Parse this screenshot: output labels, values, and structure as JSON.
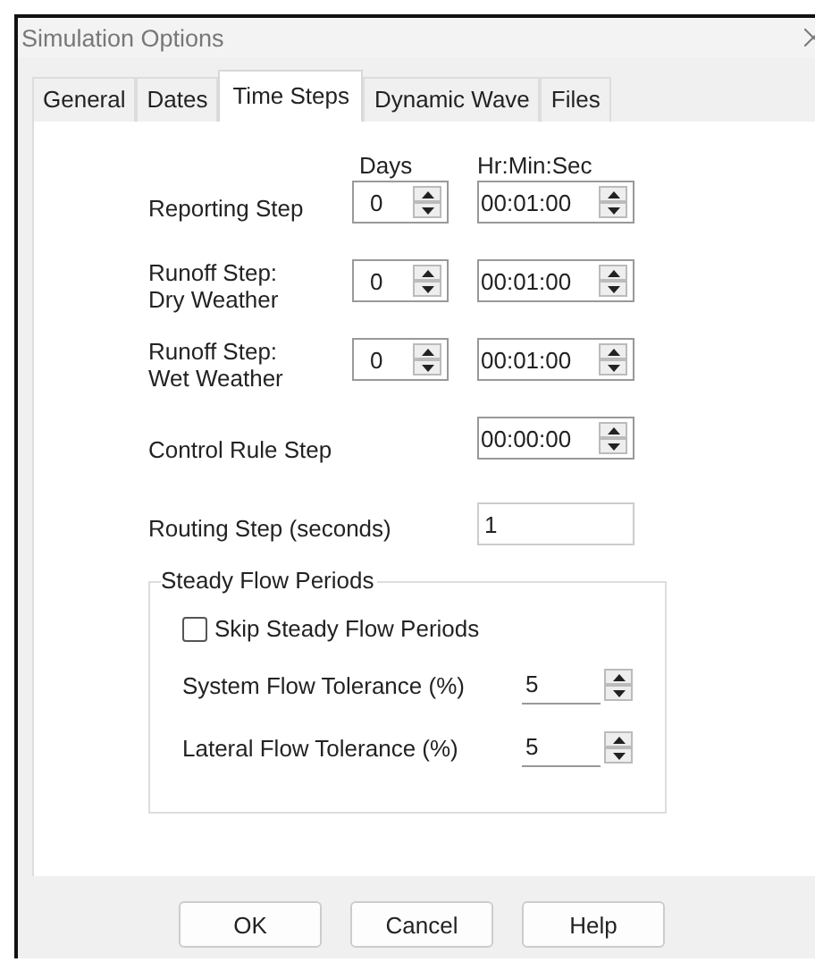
{
  "window": {
    "title": "Simulation Options"
  },
  "tabs": [
    {
      "label": "General",
      "selected": false
    },
    {
      "label": "Dates",
      "selected": false
    },
    {
      "label": "Time Steps",
      "selected": true
    },
    {
      "label": "Dynamic Wave",
      "selected": false
    },
    {
      "label": "Files",
      "selected": false
    }
  ],
  "columns": {
    "days": "Days",
    "time": "Hr:Min:Sec"
  },
  "steps": [
    {
      "kind": "days_time",
      "label": "Reporting Step",
      "days": "0",
      "time": "00:01:00"
    },
    {
      "kind": "days_time",
      "label": "Runoff Step:\nDry Weather",
      "days": "0",
      "time": "00:01:00"
    },
    {
      "kind": "days_time",
      "label": "Runoff Step:\nWet Weather",
      "days": "0",
      "time": "00:01:00"
    },
    {
      "kind": "time",
      "label": "Control Rule Step",
      "time": "00:00:00"
    },
    {
      "kind": "number",
      "label": "Routing Step (seconds)",
      "value": "1"
    }
  ],
  "steady_flow": {
    "legend": "Steady Flow Periods",
    "skip": {
      "label": "Skip Steady Flow Periods",
      "checked": false
    },
    "tolerances": [
      {
        "label": "System Flow Tolerance (%)",
        "value": "5"
      },
      {
        "label": "Lateral Flow Tolerance (%)",
        "value": "5"
      }
    ]
  },
  "buttons": [
    "OK",
    "Cancel",
    "Help"
  ]
}
